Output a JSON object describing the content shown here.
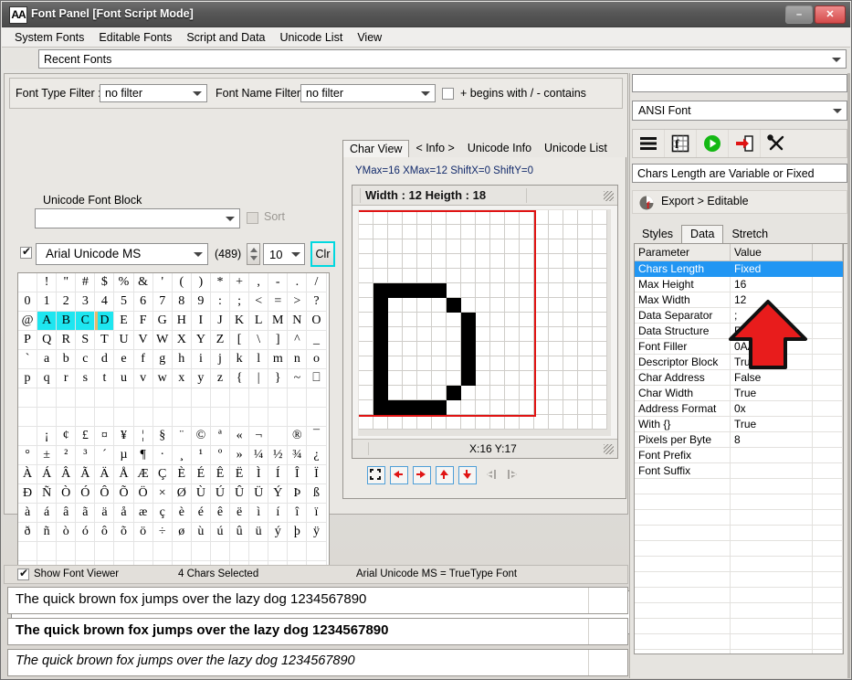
{
  "window": {
    "icon": "AA",
    "title": "Font Panel [Font Script Mode]",
    "minimize_label": "–",
    "close_label": "✕"
  },
  "menu": [
    "System Fonts",
    "Editable Fonts",
    "Script and Data",
    "Unicode List",
    "View"
  ],
  "recent_fonts": {
    "value": "Recent Fonts"
  },
  "filters": {
    "type_label": "Font Type Filter :",
    "type_value": "no filter",
    "name_label": "Font Name Filter :",
    "name_value": "no filter",
    "mode_label": "+ begins with / - contains",
    "mode_checked": false
  },
  "unicode_block": {
    "label": "Unicode Font Block",
    "value": "",
    "sort_label": "Sort",
    "sort_checked": false
  },
  "font_select": {
    "enabled": true,
    "font_name": "Arial Unicode MS",
    "count": "(489)",
    "size": "10",
    "clear_label": "Clr"
  },
  "char_table": {
    "rows": [
      [
        " ",
        "!",
        "\"",
        "#",
        "$",
        "%",
        "&",
        "'",
        "(",
        ")",
        "*",
        "+",
        ",",
        "-",
        ".",
        "/"
      ],
      [
        "0",
        "1",
        "2",
        "3",
        "4",
        "5",
        "6",
        "7",
        "8",
        "9",
        ":",
        ";",
        "<",
        "=",
        ">",
        "?"
      ],
      [
        "@",
        "A",
        "B",
        "C",
        "D",
        "E",
        "F",
        "G",
        "H",
        "I",
        "J",
        "K",
        "L",
        "M",
        "N",
        "O"
      ],
      [
        "P",
        "Q",
        "R",
        "S",
        "T",
        "U",
        "V",
        "W",
        "X",
        "Y",
        "Z",
        "[",
        "\\",
        "]",
        "^",
        "_"
      ],
      [
        "`",
        "a",
        "b",
        "c",
        "d",
        "e",
        "f",
        "g",
        "h",
        "i",
        "j",
        "k",
        "l",
        "m",
        "n",
        "o"
      ],
      [
        "p",
        "q",
        "r",
        "s",
        "t",
        "u",
        "v",
        "w",
        "x",
        "y",
        "z",
        "{",
        "|",
        "}",
        "~",
        "⎕"
      ],
      [
        "",
        "",
        "",
        "",
        "",
        "",
        "",
        "",
        "",
        "",
        "",
        "",
        "",
        "",
        "",
        ""
      ],
      [
        "",
        "",
        "",
        "",
        "",
        "",
        "",
        "",
        "",
        "",
        "",
        "",
        "",
        "",
        "",
        ""
      ],
      [
        "",
        "¡",
        "¢",
        "£",
        "¤",
        "¥",
        "¦",
        "§",
        "¨",
        "©",
        "ª",
        "«",
        "¬",
        "­",
        "®",
        "¯"
      ],
      [
        "°",
        "±",
        "²",
        "³",
        "´",
        "µ",
        "¶",
        "·",
        "¸",
        "¹",
        "º",
        "»",
        "¼",
        "½",
        "¾",
        "¿"
      ],
      [
        "À",
        "Á",
        "Â",
        "Ã",
        "Ä",
        "Å",
        "Æ",
        "Ç",
        "È",
        "É",
        "Ê",
        "Ë",
        "Ì",
        "Í",
        "Î",
        "Ï"
      ],
      [
        "Ð",
        "Ñ",
        "Ò",
        "Ó",
        "Ô",
        "Õ",
        "Ö",
        "×",
        "Ø",
        "Ù",
        "Ú",
        "Û",
        "Ü",
        "Ý",
        "Þ",
        "ß"
      ],
      [
        "à",
        "á",
        "â",
        "ã",
        "ä",
        "å",
        "æ",
        "ç",
        "è",
        "é",
        "ê",
        "ë",
        "ì",
        "í",
        "î",
        "ï"
      ],
      [
        "ð",
        "ñ",
        "ò",
        "ó",
        "ô",
        "õ",
        "ö",
        "÷",
        "ø",
        "ù",
        "ú",
        "û",
        "ü",
        "ý",
        "þ",
        "ÿ"
      ],
      [
        "",
        "",
        "",
        "",
        "",
        "",
        "",
        "",
        "",
        "",
        "",
        "",
        "",
        "",
        "",
        ""
      ],
      [
        "",
        "",
        "",
        "",
        "",
        "",
        "",
        "",
        "",
        "",
        "",
        "",
        "",
        "",
        "",
        ""
      ]
    ],
    "selected": [
      [
        2,
        1
      ],
      [
        2,
        2
      ],
      [
        2,
        3
      ],
      [
        2,
        4
      ]
    ],
    "cursor": [
      2,
      4
    ],
    "selected_color": "#1ee6f0",
    "cursor_color": "#e8b96b"
  },
  "char_view": {
    "tabs": [
      "Char View",
      "< Info >",
      "Unicode Info",
      "Unicode List"
    ],
    "active_tab": "Char View",
    "meta": "YMax=16  XMax=12  ShiftX=0  ShiftY=0",
    "caption": "Width : 12  Heigth : 18",
    "status": "X:16 Y:17",
    "grid_cols": 17,
    "grid_rows": 15,
    "bitmap_on": [
      [
        5,
        1
      ],
      [
        5,
        2
      ],
      [
        5,
        3
      ],
      [
        5,
        4
      ],
      [
        5,
        5
      ],
      [
        6,
        1
      ],
      [
        6,
        6
      ],
      [
        7,
        1
      ],
      [
        7,
        7
      ],
      [
        8,
        1
      ],
      [
        8,
        7
      ],
      [
        9,
        1
      ],
      [
        9,
        7
      ],
      [
        10,
        1
      ],
      [
        10,
        7
      ],
      [
        11,
        1
      ],
      [
        11,
        7
      ],
      [
        12,
        1
      ],
      [
        12,
        6
      ],
      [
        13,
        1
      ],
      [
        13,
        2
      ],
      [
        13,
        3
      ],
      [
        13,
        4
      ],
      [
        13,
        5
      ]
    ],
    "red_frame": {
      "left": 0,
      "top": 0,
      "cols": 12,
      "rows": 14
    },
    "toolbar_icons": [
      "fit-icon",
      "move-left-icon",
      "move-right-icon",
      "move-up-icon",
      "move-down-icon",
      "prev-char-icon",
      "next-char-icon"
    ]
  },
  "editor": {
    "text": "ABCD"
  },
  "status": {
    "show_viewer_label": "Show Font Viewer",
    "show_viewer_checked": true,
    "selection": "4 Chars Selected",
    "font_info": "Arial Unicode MS = TrueType Font"
  },
  "samples": [
    {
      "text": "The quick brown fox jumps over the lazy dog 1234567890",
      "style": "regular"
    },
    {
      "text": "The quick brown fox jumps over the lazy dog 1234567890",
      "style": "bold"
    },
    {
      "text": "The quick brown fox jumps over the lazy dog 1234567890",
      "style": "italic"
    }
  ],
  "right_panel": {
    "top_value": "",
    "font_mode": "ANSI Font",
    "tool_icons": [
      "list-lines-icon",
      "font-table-icon",
      "run-play-icon",
      "export-arrow-icon",
      "tools-wrench-icon"
    ],
    "hint": "Chars Length are Variable or Fixed",
    "export_label": "Export > Editable",
    "tabs": [
      "Styles",
      "Data",
      "Stretch"
    ],
    "active_tab": "Data",
    "table": {
      "headers": [
        "Parameter",
        "Value",
        ""
      ],
      "selected_row": 0,
      "rows": [
        [
          "Chars Length",
          "Fixed",
          ""
        ],
        [
          "Max Height",
          "16",
          ""
        ],
        [
          "Max Width",
          "12",
          ""
        ],
        [
          "Data Separator",
          ";",
          ""
        ],
        [
          "Data Structure",
          "Row",
          ""
        ],
        [
          "Font Filler",
          "0AA",
          ""
        ],
        [
          "Descriptor Block",
          "True",
          ""
        ],
        [
          "Char Address",
          "False",
          ""
        ],
        [
          "Char Width",
          "True",
          ""
        ],
        [
          "Address Format",
          "0x",
          ""
        ],
        [
          "With {}",
          "True",
          ""
        ],
        [
          "Pixels per Byte",
          "8",
          ""
        ],
        [
          "Font Prefix",
          "",
          ""
        ],
        [
          "Font Suffix",
          "",
          ""
        ]
      ]
    }
  },
  "annotation": {
    "type": "arrow-up",
    "color": "#e81c1c"
  },
  "colors": {
    "accent": "#2196f3",
    "highlight": "#1ee6f0",
    "annotation_red": "#e81c1c",
    "title_bar": "#575757"
  }
}
